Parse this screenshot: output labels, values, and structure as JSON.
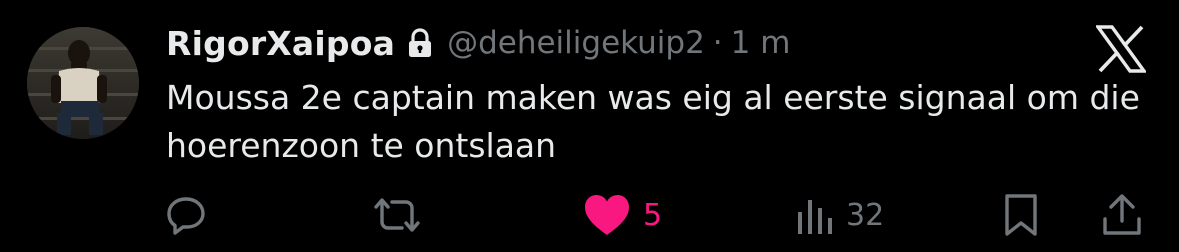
{
  "tweet": {
    "display_name": "RigorXaipoa",
    "handle": "@deheiligekuip2",
    "separator": "·",
    "time": "1 m",
    "text": "Moussa 2e captain maken was eig al eerste signaal om die hoerenzoon te ontslaan"
  },
  "actions": {
    "reply_icon": "reply-icon",
    "retweet_icon": "retweet-icon",
    "like_icon": "heart-icon",
    "like_count": "5",
    "views_icon": "views-icon",
    "views_count": "32",
    "bookmark_icon": "bookmark-icon",
    "share_icon": "share-icon"
  },
  "colors": {
    "background": "#000000",
    "text_primary": "#e7e9ea",
    "text_secondary": "#71767b",
    "like_active": "#f91880"
  }
}
